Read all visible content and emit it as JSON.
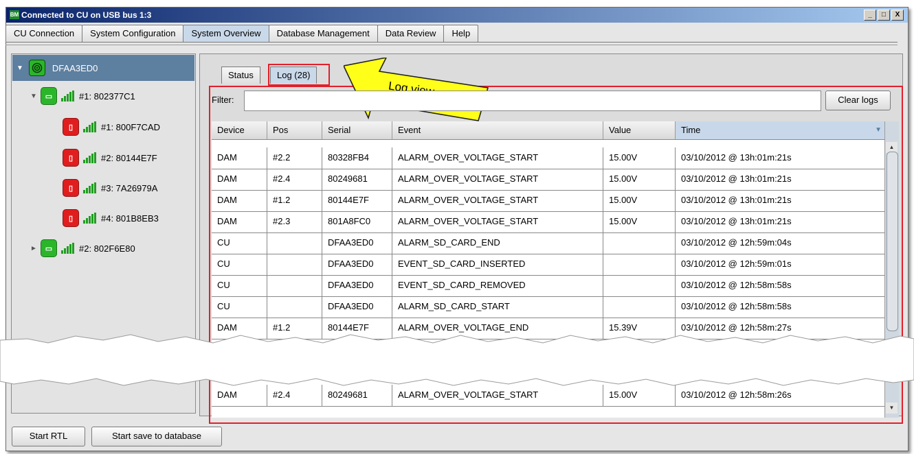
{
  "window": {
    "title": "Connected to CU on USB bus 1:3",
    "app_icon_text": "BM",
    "controls": [
      "_",
      "□",
      "X"
    ]
  },
  "main_tabs": [
    {
      "label": "CU Connection"
    },
    {
      "label": "System Configuration"
    },
    {
      "label": "System Overview"
    },
    {
      "label": "Database Management"
    },
    {
      "label": "Data Review"
    },
    {
      "label": "Help"
    }
  ],
  "tree": {
    "root": {
      "label": "DFAA3ED0"
    },
    "nodes": [
      {
        "label": "#1: 802377C1",
        "battery": "green"
      },
      {
        "label": "#1: 800F7CAD",
        "battery": "red"
      },
      {
        "label": "#2: 80144E7F",
        "battery": "red"
      },
      {
        "label": "#3: 7A26979A",
        "battery": "red"
      },
      {
        "label": "#4: 801B8EB3",
        "battery": "red"
      },
      {
        "label": "#2: 802F6E80",
        "battery": "green"
      }
    ]
  },
  "sub_tabs": [
    {
      "label": "Status"
    },
    {
      "label": "Log (28)"
    }
  ],
  "annotation": {
    "text": "Log view",
    "color": "#ffff00"
  },
  "filter": {
    "label": "Filter:",
    "value": ""
  },
  "clear_logs_label": "Clear logs",
  "table": {
    "columns": [
      "Device",
      "Pos",
      "Serial",
      "Event",
      "Value",
      "Time"
    ],
    "rows": [
      {
        "device": "DAM",
        "pos": "#2.2",
        "serial": "80328FB4",
        "event": "ALARM_OVER_VOLTAGE_START",
        "value": "15.00V",
        "time": "03/10/2012 @ 13h:01m:21s"
      },
      {
        "device": "DAM",
        "pos": "#2.4",
        "serial": "80249681",
        "event": "ALARM_OVER_VOLTAGE_START",
        "value": "15.00V",
        "time": "03/10/2012 @ 13h:01m:21s"
      },
      {
        "device": "DAM",
        "pos": "#1.2",
        "serial": "80144E7F",
        "event": "ALARM_OVER_VOLTAGE_START",
        "value": "15.00V",
        "time": "03/10/2012 @ 13h:01m:21s"
      },
      {
        "device": "DAM",
        "pos": "#2.3",
        "serial": "801A8FC0",
        "event": "ALARM_OVER_VOLTAGE_START",
        "value": "15.00V",
        "time": "03/10/2012 @ 13h:01m:21s"
      },
      {
        "device": "CU",
        "pos": "",
        "serial": "DFAA3ED0",
        "event": "ALARM_SD_CARD_END",
        "value": "",
        "time": "03/10/2012 @ 12h:59m:04s"
      },
      {
        "device": "CU",
        "pos": "",
        "serial": "DFAA3ED0",
        "event": "EVENT_SD_CARD_INSERTED",
        "value": "",
        "time": "03/10/2012 @ 12h:59m:01s"
      },
      {
        "device": "CU",
        "pos": "",
        "serial": "DFAA3ED0",
        "event": "EVENT_SD_CARD_REMOVED",
        "value": "",
        "time": "03/10/2012 @ 12h:58m:58s"
      },
      {
        "device": "CU",
        "pos": "",
        "serial": "DFAA3ED0",
        "event": "ALARM_SD_CARD_START",
        "value": "",
        "time": "03/10/2012 @ 12h:58m:58s"
      },
      {
        "device": "DAM",
        "pos": "#1.2",
        "serial": "80144E7F",
        "event": "ALARM_OVER_VOLTAGE_END",
        "value": "15.39V",
        "time": "03/10/2012 @ 12h:58m:27s"
      }
    ],
    "rows_after_break": [
      {
        "device": "DAM",
        "pos": "#2.4",
        "serial": "80249681",
        "event": "ALARM_OVER_VOLTAGE_START",
        "value": "15.00V",
        "time": "03/10/2012 @ 12h:58m:26s"
      }
    ]
  },
  "bottom_buttons": [
    {
      "label": "Start RTL"
    },
    {
      "label": "Start save to database"
    }
  ],
  "colors": {
    "selected_tree_bg": "#5d7fa0",
    "highlight_box": "#e0202b",
    "battery_green": "#2bb52b",
    "battery_red": "#e01e1e",
    "signal_green": "#1f9e1f"
  }
}
